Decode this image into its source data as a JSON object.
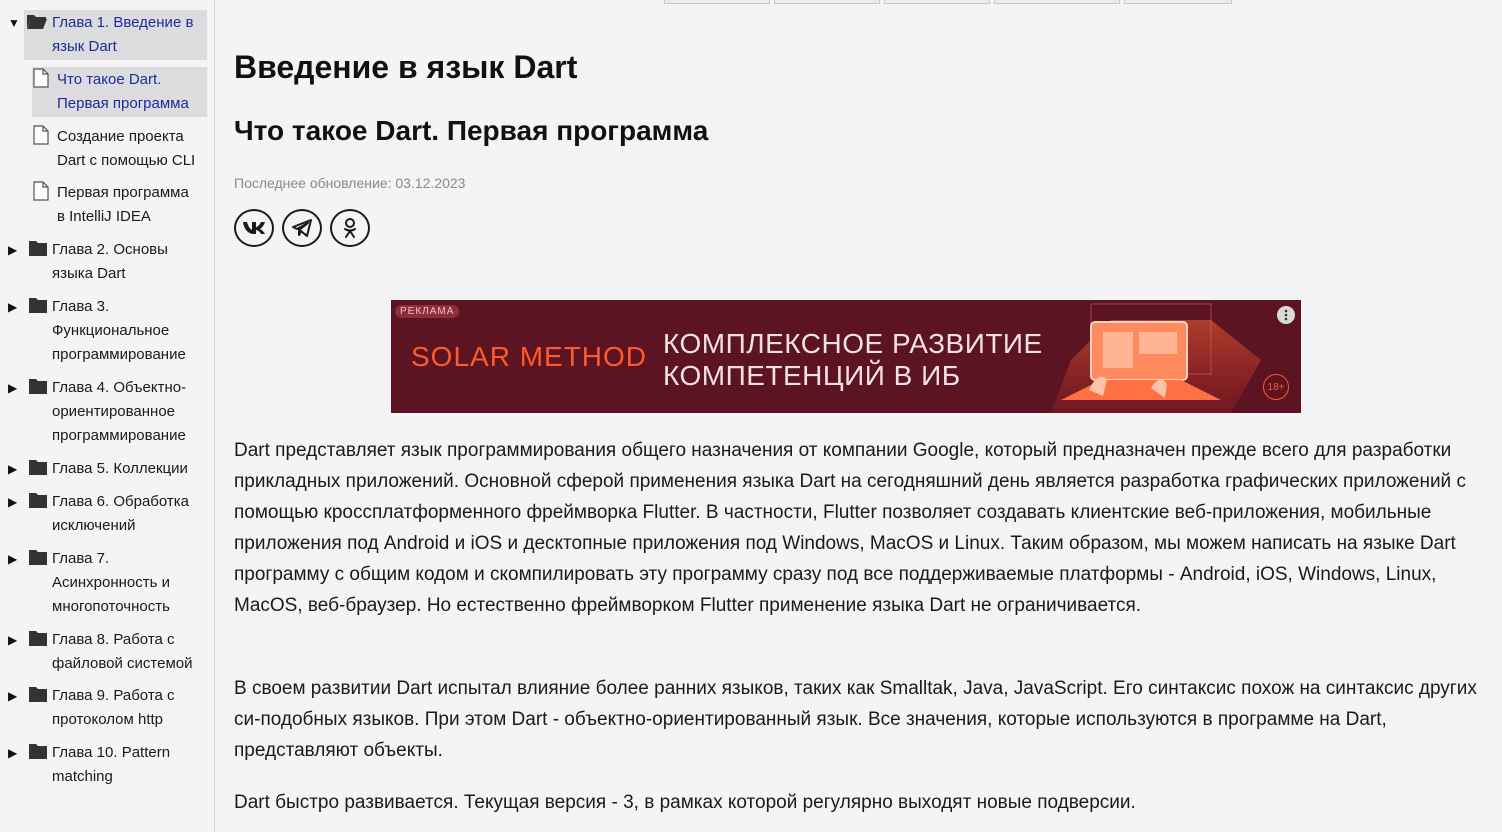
{
  "sidebar": {
    "items": [
      {
        "type": "chapter",
        "expanded": true,
        "label_lines": [
          "Глава 1. Введение в",
          "язык Dart"
        ],
        "active": true
      },
      {
        "type": "page",
        "label_lines": [
          "Что такое Dart.",
          "Первая программа"
        ],
        "active": true
      },
      {
        "type": "page",
        "label_lines": [
          "Создание проекта",
          "Dart с помощью CLI"
        ]
      },
      {
        "type": "page",
        "label_lines": [
          "Первая программа",
          "в IntelliJ IDEA"
        ]
      },
      {
        "type": "chapter",
        "label_lines": [
          "Глава 2. Основы",
          "языка Dart"
        ]
      },
      {
        "type": "chapter",
        "label_lines": [
          "Глава 3.",
          "Функциональное",
          "программирование"
        ]
      },
      {
        "type": "chapter",
        "label_lines": [
          "Глава 4. Объектно-",
          "ориентированное",
          "программирование"
        ]
      },
      {
        "type": "chapter",
        "label_lines": [
          "Глава 5. Коллекции"
        ]
      },
      {
        "type": "chapter",
        "label_lines": [
          "Глава 6. Обработка",
          "исключений"
        ]
      },
      {
        "type": "chapter",
        "label_lines": [
          "Глава 7.",
          "Асинхронность и",
          "многопоточность"
        ]
      },
      {
        "type": "chapter",
        "label_lines": [
          "Глава 8. Работа с",
          "файловой системой"
        ]
      },
      {
        "type": "chapter",
        "label_lines": [
          "Глава 9. Работа с",
          "протоколом http"
        ]
      },
      {
        "type": "chapter",
        "label_lines": [
          "Глава 10. Pattern",
          "matching"
        ]
      }
    ]
  },
  "main": {
    "title": "Введение в язык Dart",
    "subtitle": "Что такое Dart. Первая программа",
    "updated": "Последнее обновление: 03.12.2023",
    "share": [
      "vk-icon",
      "telegram-icon",
      "odnoklassniki-icon"
    ],
    "ad": {
      "badge": "РЕКЛАМА",
      "brand": "SOLAR METHOD",
      "text": "КОМПЛЕКСНОЕ РАЗВИТИЕ\nКОМПЕТЕНЦИЙ В ИБ",
      "age": "18+"
    },
    "paragraphs": [
      "Dart представляет язык программирования общего назначения от компании Google, который предназначен прежде всего для разработки прикладных приложений. Основной сферой применения языка Dart на сегодняшний день является разработка графических приложений с помощью кроссплатформенного фреймворка Flutter. В частности, Flutter позволяет создавать клиентские веб-приложения, мобильные приложения под Android и iOS и десктопные приложения под Windows, MacOS и Linux. Таким образом, мы можем написать на языке Dart программу с общим кодом и скомпилировать эту программу сразу под все поддерживаемые платформы - Android, iOS, Windows, Linux, MacOS, веб-браузер. Но естественно фреймворком Flutter применение языка Dart не ограничивается.",
      "В своем развитии Dart испытал влияние более ранних языков, таких как Smalltak, Java, JavaScript. Его синтаксис похож на синтаксис других си-подобных языков. При этом Dart - объектно-ориентированный язык. Все значения, которые используются в программе на Dart, представляют объекты.",
      "Dart быстро развивается. Текущая версия - 3, в рамках которой регулярно выходят новые подверсии."
    ]
  },
  "colors": {
    "active_link": "#1e2a9e",
    "ad_background": "#5d1422",
    "ad_brand": "#ff5a2a"
  }
}
